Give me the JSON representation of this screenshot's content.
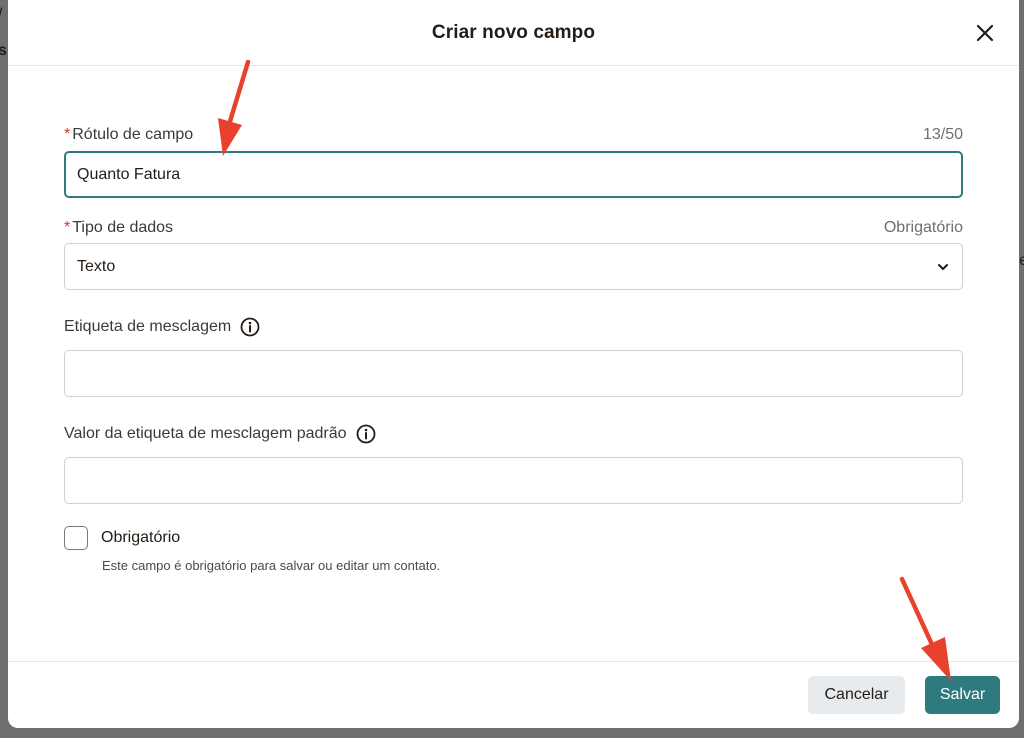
{
  "backdrop": {
    "left_text_1": "/",
    "left_text_2": "s",
    "right_text": "e"
  },
  "modal": {
    "title": "Criar novo campo",
    "close_icon": "close-icon"
  },
  "fields": {
    "label_field": {
      "required_mark": "*",
      "label": "Rótulo de campo",
      "counter": "13/50",
      "value": "Quanto Fatura"
    },
    "data_type": {
      "required_mark": "*",
      "label": "Tipo de dados",
      "hint": "Obrigatório",
      "value": "Texto",
      "icon": "chevron-down-icon"
    },
    "merge_tag": {
      "label": "Etiqueta de mesclagem",
      "icon": "info-icon",
      "value": ""
    },
    "default_merge_value": {
      "label": "Valor da etiqueta de mesclagem padrão",
      "icon": "info-icon",
      "value": ""
    },
    "required_checkbox": {
      "label": "Obrigatório",
      "description": "Este campo é obrigatório para salvar ou editar um contato.",
      "checked": false
    }
  },
  "footer": {
    "cancel_label": "Cancelar",
    "save_label": "Salvar"
  },
  "colors": {
    "accent": "#2f7a7e",
    "required": "#d6322a",
    "annotation_arrow": "#e8412c"
  }
}
